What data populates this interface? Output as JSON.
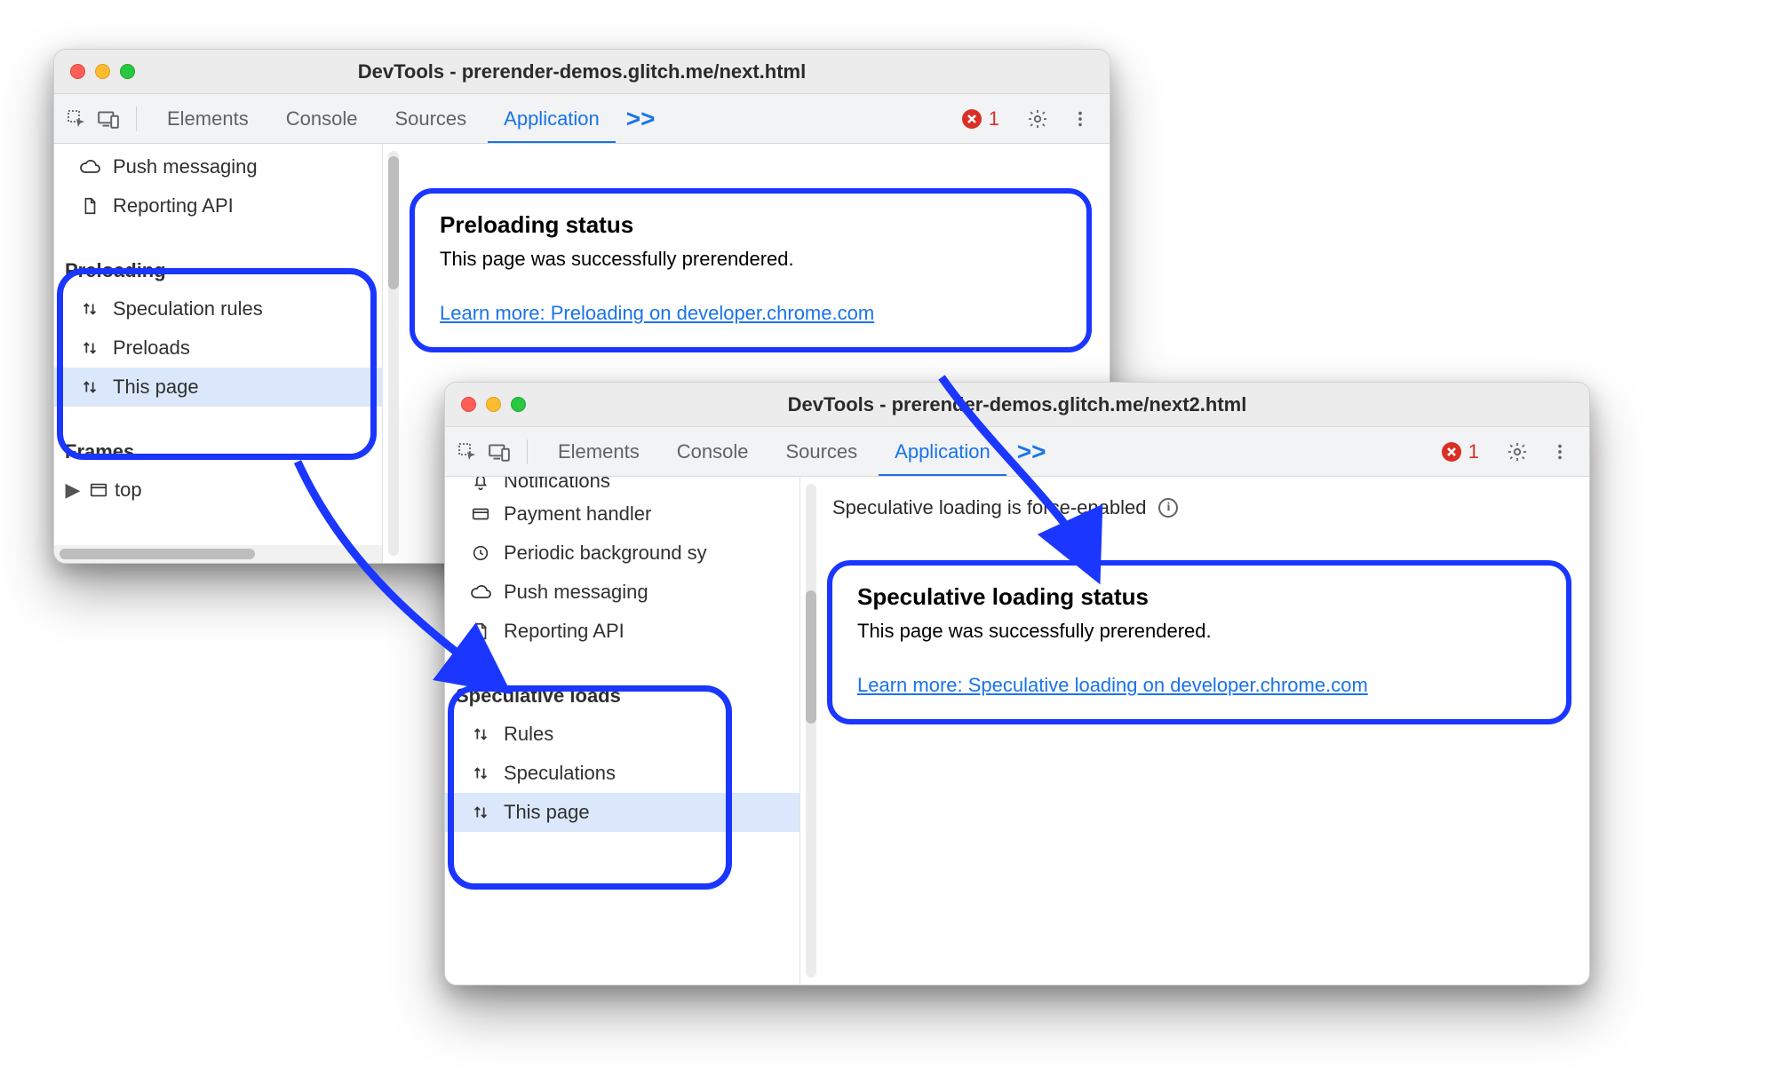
{
  "win1": {
    "title": "DevTools - prerender-demos.glitch.me/next.html",
    "tabs": {
      "elements": "Elements",
      "console": "Console",
      "sources": "Sources",
      "application": "Application"
    },
    "chevlabel": ">>",
    "error_count": "1",
    "sidebar": {
      "bg_items": [
        {
          "label": "Push messaging",
          "icon": "cloud"
        },
        {
          "label": "Reporting API",
          "icon": "file"
        }
      ],
      "section1_title": "Preloading",
      "section1_items": [
        {
          "label": "Speculation rules"
        },
        {
          "label": "Preloads"
        },
        {
          "label": "This page",
          "selected": true
        }
      ],
      "section2_title": "Frames",
      "section2_item": "top"
    },
    "status": {
      "title": "Preloading status",
      "desc": "This page was successfully prerendered.",
      "link": "Learn more: Preloading on developer.chrome.com"
    }
  },
  "win2": {
    "title": "DevTools - prerender-demos.glitch.me/next2.html",
    "tabs": {
      "elements": "Elements",
      "console": "Console",
      "sources": "Sources",
      "application": "Application"
    },
    "chevlabel": ">>",
    "error_count": "1",
    "banner": "Speculative loading is force-enabled",
    "sidebar": {
      "bg_items": [
        {
          "label": "Notifications",
          "icon": "bell"
        },
        {
          "label": "Payment handler",
          "icon": "card"
        },
        {
          "label": "Periodic background sy",
          "icon": "clock"
        },
        {
          "label": "Push messaging",
          "icon": "cloud"
        },
        {
          "label": "Reporting API",
          "icon": "file"
        }
      ],
      "section1_title": "Speculative loads",
      "section1_items": [
        {
          "label": "Rules"
        },
        {
          "label": "Speculations"
        },
        {
          "label": "This page",
          "selected": true
        }
      ]
    },
    "status": {
      "title": "Speculative loading status",
      "desc": "This page was successfully prerendered.",
      "link": "Learn more: Speculative loading on developer.chrome.com"
    }
  }
}
